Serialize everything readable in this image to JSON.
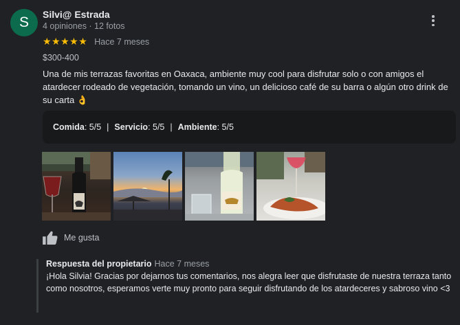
{
  "review": {
    "avatar_letter": "S",
    "author": "Silvi@ Estrada",
    "author_meta": "4 opiniones · 12 fotos",
    "rating": 5,
    "stars": "★★★★★",
    "time": "Hace 7 meses",
    "price": "$300-400",
    "text": "Una de mis terrazas favoritas en Oaxaca, ambiente muy cool para disfrutar solo o con amigos el atardecer rodeado de vegetación, tomando un vino, un delicioso café de su barra o algún otro drink de su carta",
    "emoji": "👌",
    "attributes": [
      {
        "label": "Comida",
        "value": ": 5/5"
      },
      {
        "label": "Servicio",
        "value": ": 5/5"
      },
      {
        "label": "Ambiente",
        "value": ": 5/5"
      }
    ],
    "attr_separator": "|",
    "like_label": "Me gusta"
  },
  "reply": {
    "title": "Respuesta del propietario",
    "time": "Hace 7 meses",
    "text": "¡Hola Silvia! Gracias por dejarnos tus comentarios, nos alegra leer que disfrutaste de nuestra terraza tanto como nosotros, esperamos verte muy pronto para seguir disfrutando de los atardeceres y sabroso vino <3"
  },
  "colors": {
    "background": "#202124",
    "avatar": "#0b6b4c",
    "star": "#fbbc04"
  },
  "icons": {
    "more": "more-vert-icon",
    "like": "thumb-up-icon"
  }
}
